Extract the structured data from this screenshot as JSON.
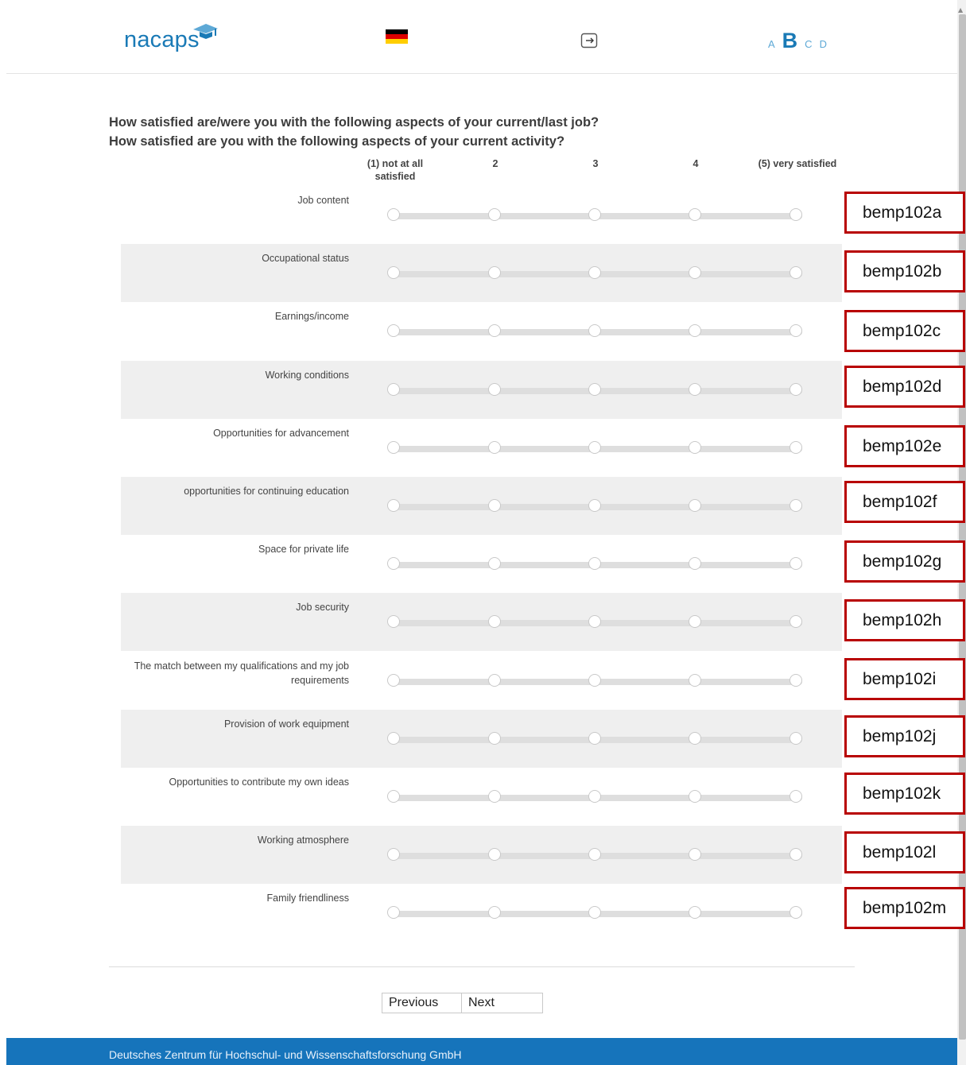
{
  "header": {
    "logo_text": "nacaps",
    "language_flag": "flag-germany-icon",
    "logout_icon": "logout-icon",
    "font_size_options": [
      "A",
      "B",
      "C",
      "D"
    ],
    "font_size_selected": "B"
  },
  "question": {
    "line1": "How satisfied are/were you with the following aspects of your current/last job?",
    "line2": "How satisfied are you with the following aspects of your current activity?"
  },
  "scale": {
    "labels": [
      "(1) not at all satisfied",
      "2",
      "3",
      "4",
      "(5) very satisfied"
    ]
  },
  "items": [
    {
      "label": "Job content",
      "variable": "bemp102a"
    },
    {
      "label": "Occupational status",
      "variable": "bemp102b"
    },
    {
      "label": "Earnings/income",
      "variable": "bemp102c"
    },
    {
      "label": "Working conditions",
      "variable": "bemp102d"
    },
    {
      "label": "Opportunities for advancement",
      "variable": "bemp102e"
    },
    {
      "label": "opportunities for continuing education",
      "variable": "bemp102f"
    },
    {
      "label": "Space for private life",
      "variable": "bemp102g"
    },
    {
      "label": "Job security",
      "variable": "bemp102h"
    },
    {
      "label": "The match between my qualifications and my job requirements",
      "variable": "bemp102i"
    },
    {
      "label": "Provision of work equipment",
      "variable": "bemp102j"
    },
    {
      "label": "Opportunities to contribute my own ideas",
      "variable": "bemp102k"
    },
    {
      "label": "Working atmosphere",
      "variable": "bemp102l"
    },
    {
      "label": "Family friendliness",
      "variable": "bemp102m"
    }
  ],
  "navigation": {
    "previous_label": "Previous",
    "next_label": "Next"
  },
  "footer": {
    "text": "Deutsches Zentrum für Hochschul- und Wissenschaftsforschung GmbH"
  },
  "colors": {
    "brand_blue": "#1a7ab6",
    "footer_blue": "#1674bb",
    "annotation_red": "#b80000",
    "row_shade": "#efefef"
  }
}
